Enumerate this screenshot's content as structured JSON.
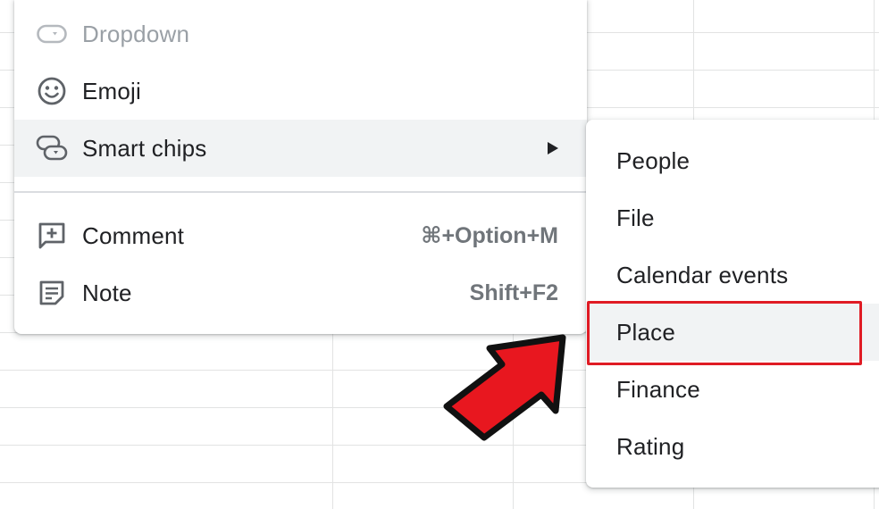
{
  "menu": {
    "items": [
      {
        "label": "Dropdown",
        "icon": "dropdown-icon",
        "disabled": true,
        "shortcut": ""
      },
      {
        "label": "Emoji",
        "icon": "emoji-icon",
        "disabled": false,
        "shortcut": ""
      },
      {
        "label": "Smart chips",
        "icon": "smart-chips-icon",
        "disabled": false,
        "shortcut": "",
        "has_submenu": true
      },
      {
        "label": "Comment",
        "icon": "comment-icon",
        "disabled": false,
        "shortcut": "⌘+Option+M"
      },
      {
        "label": "Note",
        "icon": "note-icon",
        "disabled": false,
        "shortcut": "Shift+F2"
      }
    ]
  },
  "submenu": {
    "items": [
      {
        "label": "People"
      },
      {
        "label": "File"
      },
      {
        "label": "Calendar events"
      },
      {
        "label": "Place"
      },
      {
        "label": "Finance"
      },
      {
        "label": "Rating"
      }
    ],
    "highlighted": "Place"
  },
  "colors": {
    "highlight_border": "#e01b24",
    "arrow_fill": "#e8171f",
    "hover_bg": "#f1f3f4"
  }
}
